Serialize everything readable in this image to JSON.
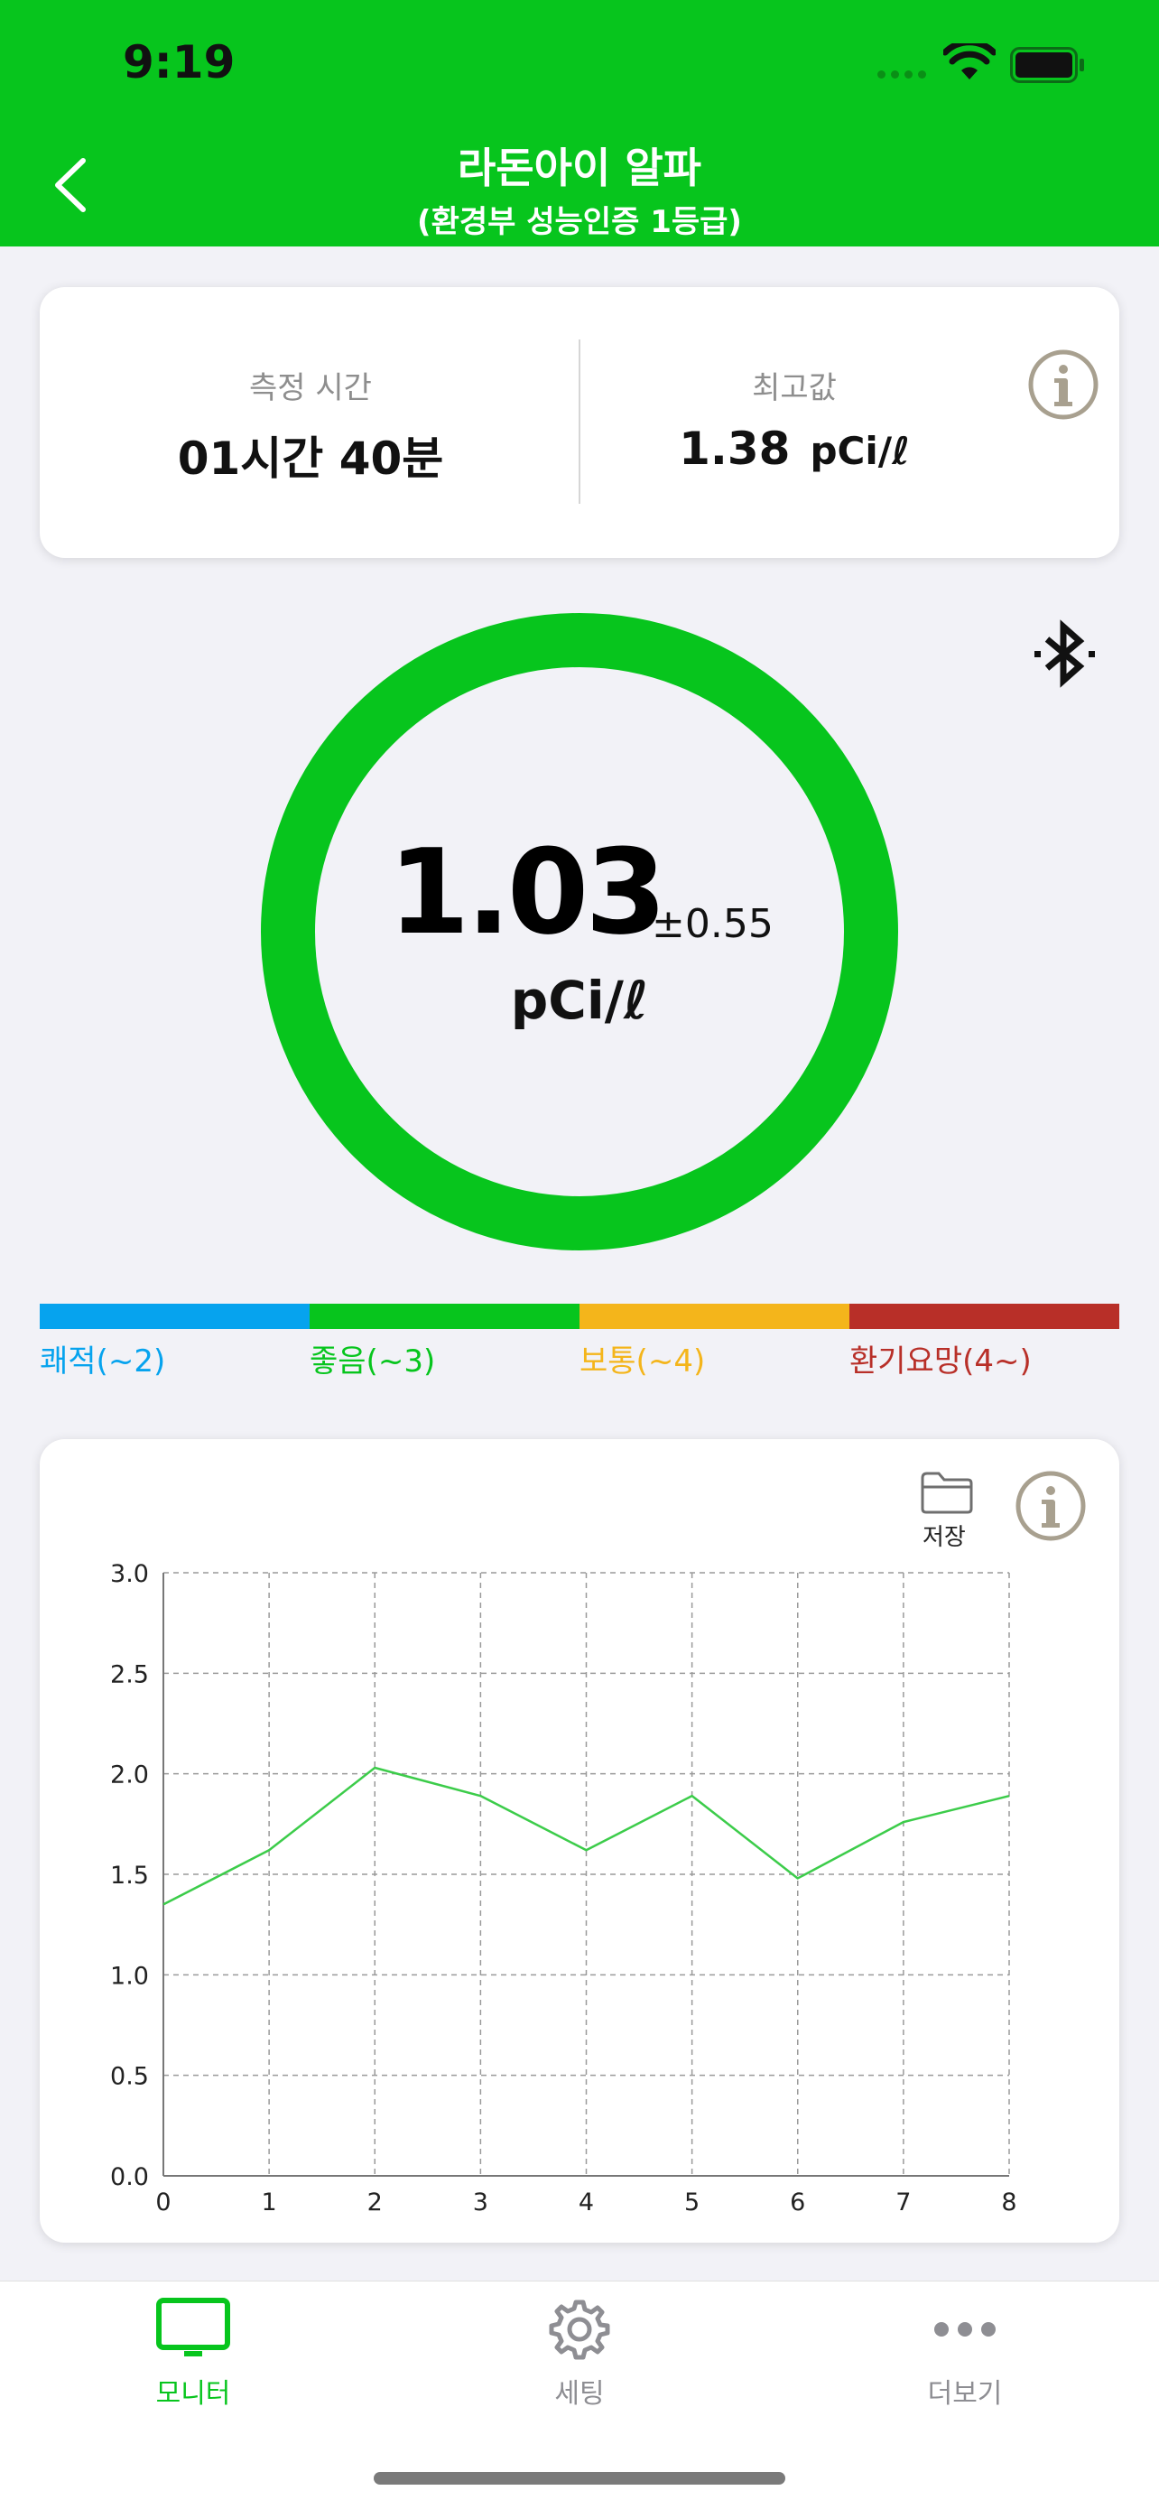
{
  "status_bar": {
    "time": "9:19"
  },
  "header": {
    "title": "라돈아이 알파",
    "subtitle": "(환경부 성능인증 1등급)"
  },
  "info_card": {
    "measure_time_label": "측정 시간",
    "measure_time_value": "01시간 40분",
    "max_label": "최고값",
    "max_value": "1.38",
    "max_unit": "pCi/ℓ"
  },
  "gauge": {
    "value": "1.03",
    "plus_minus": "±0.55",
    "unit": "pCi/ℓ",
    "ring_color": "#07c51d"
  },
  "legend": {
    "items": [
      {
        "label": "쾌적(~2)",
        "color": "#06a3ee"
      },
      {
        "label": "좋음(~3)",
        "color": "#07c51d"
      },
      {
        "label": "보통(~4)",
        "color": "#f4b51b"
      },
      {
        "label": "환기요망(4~)",
        "color": "#b82f28"
      }
    ]
  },
  "chart_card": {
    "save_label": "저장",
    "icons": {
      "save": "folder-icon",
      "info": "info-icon"
    }
  },
  "chart_data": {
    "type": "line",
    "x": [
      0,
      1,
      2,
      3,
      4,
      5,
      6,
      7,
      8
    ],
    "x_tick_labels": [
      "0",
      "1",
      "2",
      "3",
      "4",
      "5",
      "6",
      "7",
      "8"
    ],
    "y_tick_labels": [
      "0.0",
      "0.5",
      "1.0",
      "1.5",
      "2.0",
      "2.5",
      "3.0"
    ],
    "ylim": [
      0,
      3
    ],
    "xlim": [
      0,
      8
    ],
    "grid": true,
    "series": [
      {
        "values": [
          1.35,
          1.62,
          2.03,
          1.89,
          1.62,
          1.89,
          1.48,
          1.76,
          1.89
        ],
        "color": "#3ccc4a"
      }
    ]
  },
  "tabbar": {
    "tabs": [
      {
        "label": "모니터",
        "icon": "monitor-icon",
        "active": true
      },
      {
        "label": "세팅",
        "icon": "gear-icon",
        "active": false
      },
      {
        "label": "더보기",
        "icon": "more-icon",
        "active": false
      }
    ],
    "active_color": "#07c51d",
    "inactive_color": "#8e8e93"
  }
}
